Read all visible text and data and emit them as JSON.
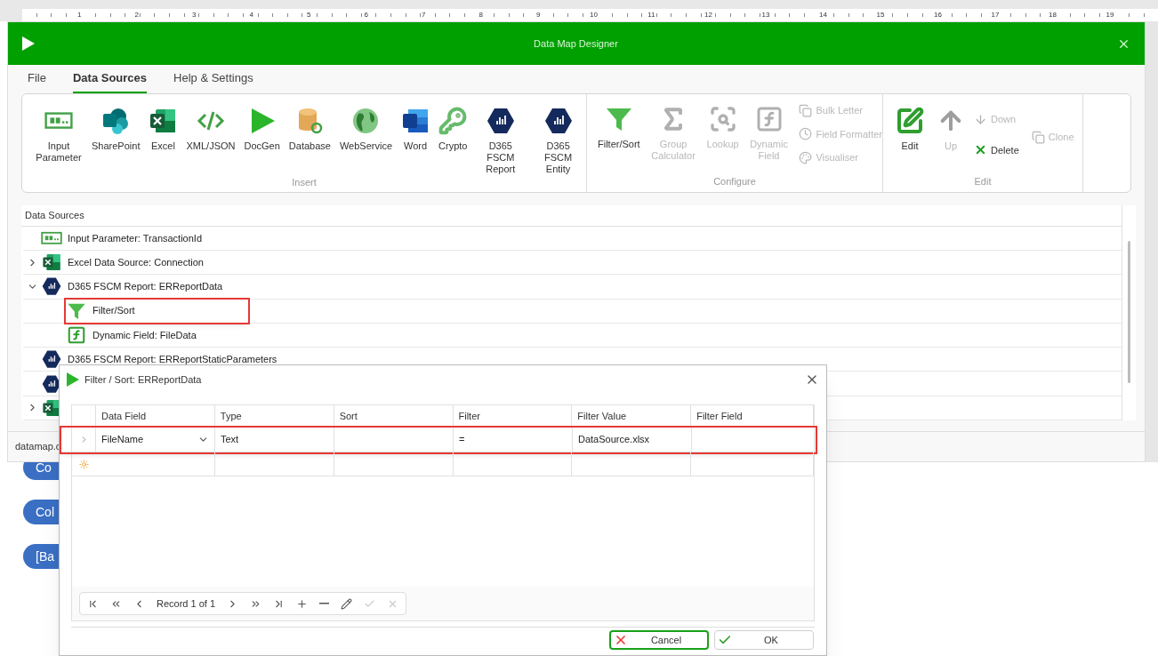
{
  "ruler": {
    "labels": [
      "1",
      "2",
      "3",
      "4",
      "5",
      "6",
      "7",
      "8",
      "9",
      "10",
      "11",
      "12",
      "13",
      "14",
      "15",
      "16",
      "17",
      "18",
      "19"
    ]
  },
  "window": {
    "title": "Data Map Designer"
  },
  "tabs": [
    {
      "label": "File",
      "selected": false
    },
    {
      "label": "Data Sources",
      "selected": true
    },
    {
      "label": "Help & Settings",
      "selected": false
    }
  ],
  "ribbon": {
    "insert": {
      "label": "Insert",
      "items": [
        {
          "kind": "input",
          "label": "Input Parameter"
        },
        {
          "kind": "sharepoint",
          "label": "SharePoint"
        },
        {
          "kind": "excel",
          "label": "Excel"
        },
        {
          "kind": "code",
          "label": "XML/JSON"
        },
        {
          "kind": "play",
          "label": "DocGen"
        },
        {
          "kind": "database",
          "label": "Database"
        },
        {
          "kind": "globe",
          "label": "WebService"
        },
        {
          "kind": "word",
          "label": "Word"
        },
        {
          "kind": "key",
          "label": "Crypto"
        },
        {
          "kind": "d365",
          "label": "D365 FSCM Report"
        },
        {
          "kind": "d365",
          "label": "D365 FSCM Entity"
        }
      ]
    },
    "configure": {
      "label": "Configure",
      "large": [
        {
          "kind": "filter",
          "label": "Filter/Sort",
          "disabled": false
        },
        {
          "kind": "sigma",
          "label": "Group Calculator",
          "disabled": true
        },
        {
          "kind": "lookup",
          "label": "Lookup",
          "disabled": true
        },
        {
          "kind": "function",
          "label": "Dynamic Field",
          "disabled": true
        }
      ],
      "small": [
        {
          "kind": "copy",
          "label": "Bulk Letter",
          "disabled": true
        },
        {
          "kind": "clock",
          "label": "Field Formatter",
          "disabled": true
        },
        {
          "kind": "palette",
          "label": "Visualiser",
          "disabled": true
        }
      ]
    },
    "edit": {
      "label": "Edit",
      "large": [
        {
          "kind": "edit",
          "label": "Edit",
          "disabled": false
        },
        {
          "kind": "up",
          "label": "Up",
          "disabled": true
        }
      ],
      "small": [
        {
          "kind": "down",
          "label": "Down",
          "disabled": true
        },
        {
          "kind": "delete",
          "label": "Delete",
          "disabled": false
        }
      ],
      "extra": [
        {
          "kind": "copy",
          "label": "Clone",
          "disabled": true
        }
      ]
    }
  },
  "data_sources": {
    "title": "Data Sources",
    "items": [
      {
        "kind": "input",
        "label": "Input Parameter: TransactionId",
        "highlighted": false
      },
      {
        "kind": "excel",
        "label": "Excel Data Source: Connection",
        "expanded": false,
        "highlighted": false
      },
      {
        "kind": "d365",
        "label": "D365 FSCM Report: ERReportData",
        "expanded": true,
        "highlighted": false,
        "children": [
          {
            "kind": "filter",
            "label": "Filter/Sort",
            "highlighted": true
          },
          {
            "kind": "function",
            "label": "Dynamic Field: FileData",
            "highlighted": false
          }
        ]
      },
      {
        "kind": "d365",
        "label": "D365 FSCM Report: ERReportStaticParameters",
        "highlighted": false
      },
      {
        "kind": "d365",
        "highlighted": false
      },
      {
        "kind": "excel",
        "expanded": false,
        "highlighted": false
      }
    ]
  },
  "status_bar": {
    "text": "datamap.c"
  },
  "background_pills": [
    "Co",
    "Col",
    "[Ba"
  ],
  "dialog": {
    "title": "Filter / Sort: ERReportData",
    "columns": [
      "Data Field",
      "Type",
      "Sort",
      "Filter",
      "Filter Value",
      "Filter Field"
    ],
    "rows": [
      {
        "highlighted": true,
        "cells": [
          "FileName",
          "Text",
          "",
          "=",
          "DataSource.xlsx",
          ""
        ]
      }
    ],
    "navigator": {
      "record": "Record 1 of 1",
      "buttons": [
        {
          "kind": "first",
          "disabled": false
        },
        {
          "kind": "prev-page",
          "disabled": false
        },
        {
          "kind": "prev",
          "disabled": false
        },
        {
          "kind": "next",
          "disabled": false
        },
        {
          "kind": "next-page",
          "disabled": false
        },
        {
          "kind": "last",
          "disabled": false
        },
        {
          "kind": "add",
          "disabled": false
        },
        {
          "kind": "remove",
          "disabled": false
        },
        {
          "kind": "edit",
          "disabled": false
        },
        {
          "kind": "accept",
          "disabled": true
        },
        {
          "kind": "cancel",
          "disabled": true
        }
      ]
    },
    "buttons": [
      {
        "kind": "cancel",
        "label": "Cancel",
        "focused": true
      },
      {
        "kind": "ok",
        "label": "OK",
        "focused": false
      }
    ]
  }
}
